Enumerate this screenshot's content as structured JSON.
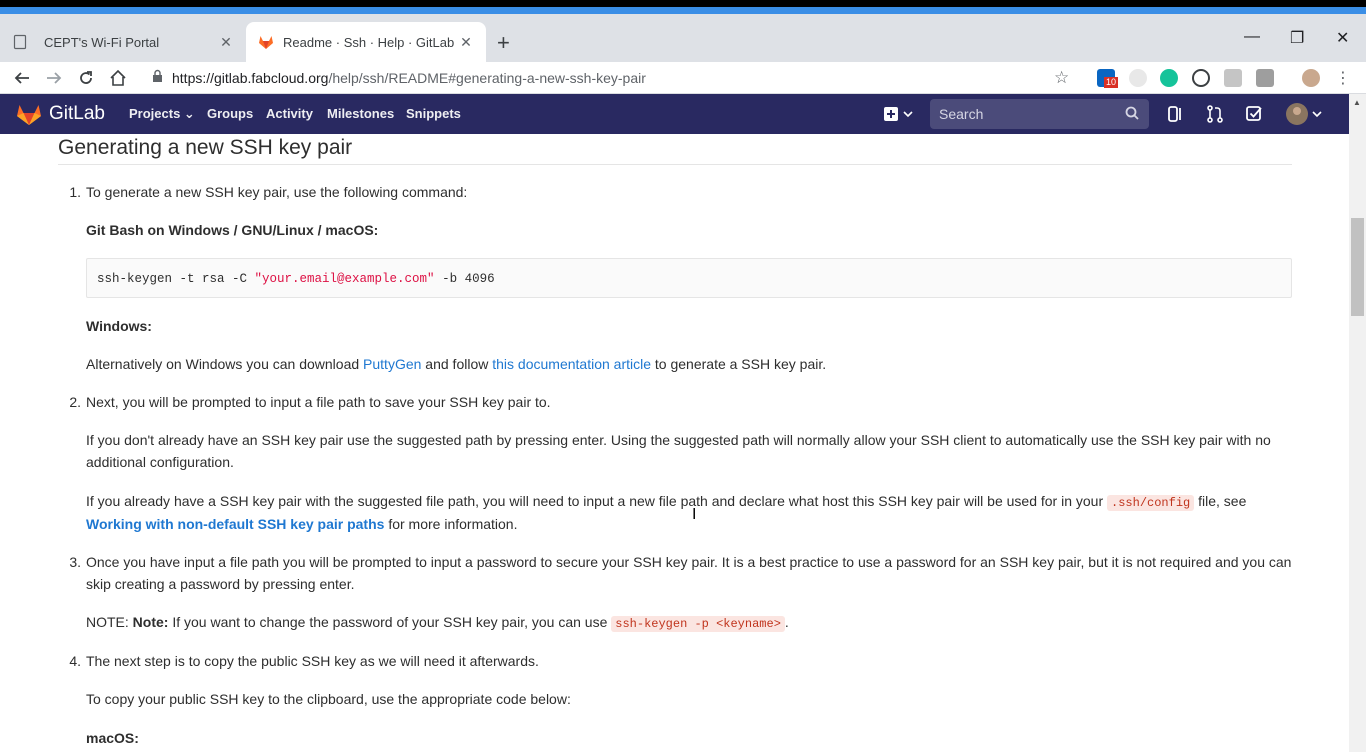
{
  "browser": {
    "tabs": [
      {
        "title": "CEPT's Wi-Fi Portal",
        "active": false
      },
      {
        "title": "Readme · Ssh · Help · GitLab",
        "active": true
      }
    ],
    "url_host": "https://gitlab.fabcloud.org",
    "url_path": "/help/ssh/README#generating-a-new-ssh-key-pair",
    "extension_badge": "10"
  },
  "gitlab_nav": {
    "brand": "GitLab",
    "links": [
      "Projects",
      "Groups",
      "Activity",
      "Milestones",
      "Snippets"
    ],
    "search_placeholder": "Search"
  },
  "doc": {
    "heading": "Generating a new SSH key pair",
    "step1": {
      "num": "1.",
      "text": "To generate a new SSH key pair, use the following command:",
      "subhead": "Git Bash on Windows / GNU/Linux / macOS:",
      "code_prefix": "ssh-keygen -t rsa -C ",
      "code_string": "\"your.email@example.com\"",
      "code_suffix": " -b 4096",
      "windows_head": "Windows:",
      "alt_1": "Alternatively on Windows you can download ",
      "alt_link1": "PuttyGen",
      "alt_2": " and follow ",
      "alt_link2": "this documentation article",
      "alt_3": " to generate a SSH key pair."
    },
    "step2": {
      "num": "2.",
      "text": "Next, you will be prompted to input a file path to save your SSH key pair to.",
      "p1_line1": "If you don't already have an SSH key pair use the suggested path by pressing enter. Using the suggested path will normally allow your SSH client to automatically use the SSH key pair with no",
      "p1_line2": "additional configuration.",
      "p2_line1": "If you already have a SSH key pair with the suggested file path, you will need to input a new file path and declare what host this SSH key pair will be used for in your ",
      "p2_code": ".ssh/config",
      "p2_line1_end": " file, see",
      "p2_link": "Working with non-default SSH key pair paths",
      "p2_line2_end": " for more information."
    },
    "step3": {
      "num": "3.",
      "line1": "Once you have input a file path you will be prompted to input a password to secure your SSH key pair. It is a best practice to use a password for an SSH key pair, but it is not required and you can",
      "line2": "skip creating a password by pressing enter.",
      "note_prefix": "NOTE: ",
      "note_bold": "Note:",
      "note_text": " If you want to change the password of your SSH key pair, you can use ",
      "note_code": "ssh-keygen -p <keyname>",
      "note_end": "."
    },
    "step4": {
      "num": "4.",
      "text": "The next step is to copy the public SSH key as we will need it afterwards.",
      "p1": "To copy your public SSH key to the clipboard, use the appropriate code below:",
      "macos": "macOS:"
    }
  }
}
